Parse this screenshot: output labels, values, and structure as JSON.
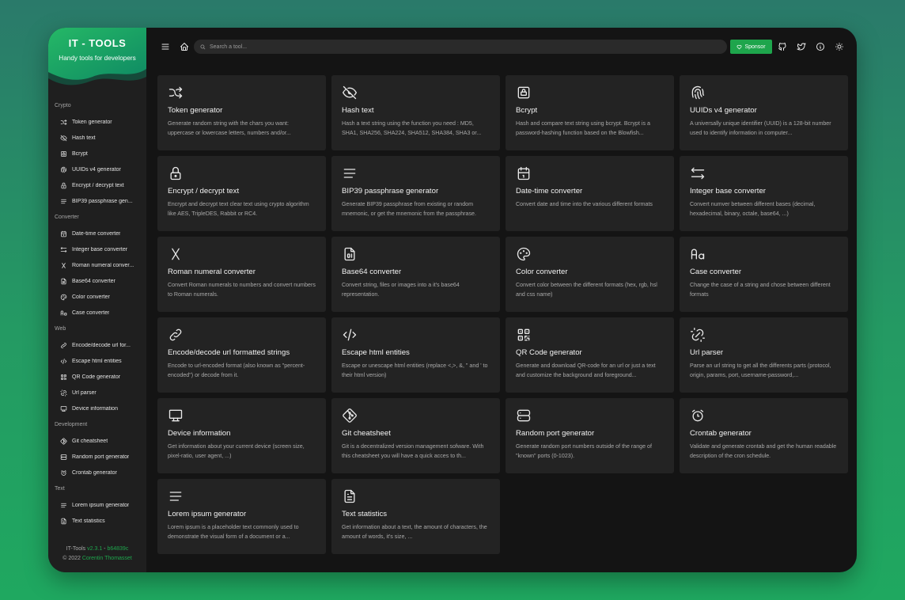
{
  "brand": {
    "title": "IT - TOOLS",
    "subtitle": "Handy tools for developers",
    "accent": "#1ea54c"
  },
  "sidebar": {
    "sections": [
      {
        "label": "Crypto",
        "items": [
          {
            "label": "Token generator",
            "icon": "shuffle-icon"
          },
          {
            "label": "Hash text",
            "icon": "eye-off-icon"
          },
          {
            "label": "Bcrypt",
            "icon": "lock-square-icon"
          },
          {
            "label": "UUIDs v4 generator",
            "icon": "fingerprint-icon"
          },
          {
            "label": "Encrypt / decrypt text",
            "icon": "lock-icon"
          },
          {
            "label": "BIP39 passphrase gen...",
            "icon": "align-justified-icon"
          }
        ]
      },
      {
        "label": "Converter",
        "items": [
          {
            "label": "Date-time converter",
            "icon": "calendar-icon"
          },
          {
            "label": "Integer base converter",
            "icon": "arrows-left-right-icon"
          },
          {
            "label": "Roman numeral conver...",
            "icon": "letter-x-icon"
          },
          {
            "label": "Base64 converter",
            "icon": "file-digit-icon"
          },
          {
            "label": "Color converter",
            "icon": "palette-icon"
          },
          {
            "label": "Case converter",
            "icon": "letter-case-icon"
          }
        ]
      },
      {
        "label": "Web",
        "items": [
          {
            "label": "Encode/decode url for...",
            "icon": "link-icon"
          },
          {
            "label": "Escape html entities",
            "icon": "code-icon"
          },
          {
            "label": "QR Code generator",
            "icon": "qrcode-icon"
          },
          {
            "label": "Url parser",
            "icon": "unlink-icon"
          },
          {
            "label": "Device information",
            "icon": "device-desktop-icon"
          }
        ]
      },
      {
        "label": "Development",
        "items": [
          {
            "label": "Git cheatsheet",
            "icon": "git-icon"
          },
          {
            "label": "Random port generator",
            "icon": "server-icon"
          },
          {
            "label": "Crontab generator",
            "icon": "alarm-icon"
          }
        ]
      },
      {
        "label": "Text",
        "items": [
          {
            "label": "Lorem ipsum generator",
            "icon": "align-justified-icon"
          },
          {
            "label": "Text statistics",
            "icon": "file-text-icon"
          }
        ]
      }
    ],
    "footer": {
      "line1_prefix": "IT-Tools",
      "version": "v2.3.1",
      "separator": "-",
      "commit": "b64839c",
      "line2_prefix": "© 2022",
      "author": "Corentin Thomasset"
    }
  },
  "topbar": {
    "search_placeholder": "Search a tool...",
    "sponsor_label": "Sponsor"
  },
  "cards": [
    {
      "icon": "shuffle-icon",
      "title": "Token generator",
      "desc": "Generate random string with the chars you want: uppercase or lowercase letters, numbers and/or..."
    },
    {
      "icon": "eye-off-icon",
      "title": "Hash text",
      "desc": "Hash a text string using the function you need : MD5, SHA1, SHA256, SHA224, SHA512, SHA384, SHA3 or..."
    },
    {
      "icon": "lock-square-icon",
      "title": "Bcrypt",
      "desc": "Hash and compare text string using bcrypt. Bcrypt is a password-hashing function based on the Blowfish..."
    },
    {
      "icon": "fingerprint-icon",
      "title": "UUIDs v4 generator",
      "desc": "A universally unique identifier (UUID) is a 128-bit number used to identify information in computer..."
    },
    {
      "icon": "lock-icon",
      "title": "Encrypt / decrypt text",
      "desc": "Encrypt and decrypt text clear text using crypto algorithm like AES, TripleDES, Rabbit or RC4."
    },
    {
      "icon": "align-justified-icon",
      "title": "BIP39 passphrase generator",
      "desc": "Generate BIP39 passphrase from existing or random mnemonic, or get the mnemonic from the passphrase."
    },
    {
      "icon": "calendar-icon",
      "title": "Date-time converter",
      "desc": "Convert date and time into the various different formats"
    },
    {
      "icon": "arrows-left-right-icon",
      "title": "Integer base converter",
      "desc": "Convert numver between different bases (decimal, hexadecimal, binary, octale, base64, ...)"
    },
    {
      "icon": "letter-x-icon",
      "title": "Roman numeral converter",
      "desc": "Convert Roman numerals to numbers and convert numbers to Roman numerals."
    },
    {
      "icon": "file-digit-icon",
      "title": "Base64 converter",
      "desc": "Convert string, files or images into a it's base64 representation."
    },
    {
      "icon": "palette-icon",
      "title": "Color converter",
      "desc": "Convert color between the different formats (hex, rgb, hsl and css name)"
    },
    {
      "icon": "letter-case-icon",
      "title": "Case converter",
      "desc": "Change the case of a string and chose between different formats"
    },
    {
      "icon": "link-icon",
      "title": "Encode/decode url formatted strings",
      "desc": "Encode to url-encoded format (also known as \"percent-encoded\") or decode from it."
    },
    {
      "icon": "code-icon",
      "title": "Escape html entities",
      "desc": "Escape or unescape html entities (replace <,>, &, \" and ' to their html version)"
    },
    {
      "icon": "qrcode-icon",
      "title": "QR Code generator",
      "desc": "Generate and download QR-code for an url or just a text and customize the background and foreground..."
    },
    {
      "icon": "unlink-icon",
      "title": "Url parser",
      "desc": "Parse an url string to get all the differents parts (protocol, origin, params, port, username-password,..."
    },
    {
      "icon": "device-desktop-icon",
      "title": "Device information",
      "desc": "Get information about your current device (screen size, pixel-ratio, user agent, ...)"
    },
    {
      "icon": "git-icon",
      "title": "Git cheatsheet",
      "desc": "Git is a decentralized version management sofware. With this cheatsheet you will have a quick acces to th..."
    },
    {
      "icon": "server-icon",
      "title": "Random port generator",
      "desc": "Generate random port numbers outside of the range of \"known\" ports (0-1023)."
    },
    {
      "icon": "alarm-icon",
      "title": "Crontab generator",
      "desc": "Validate and generate crontab and get the human readable description of the cron schedule."
    },
    {
      "icon": "align-justified-icon",
      "title": "Lorem ipsum generator",
      "desc": "Lorem ipsum is a placeholder text commonly used to demonstrate the visual form of a document or a..."
    },
    {
      "icon": "file-text-icon",
      "title": "Text statistics",
      "desc": "Get information about a text, the amount of characters, the amount of words, it's size, ..."
    }
  ]
}
